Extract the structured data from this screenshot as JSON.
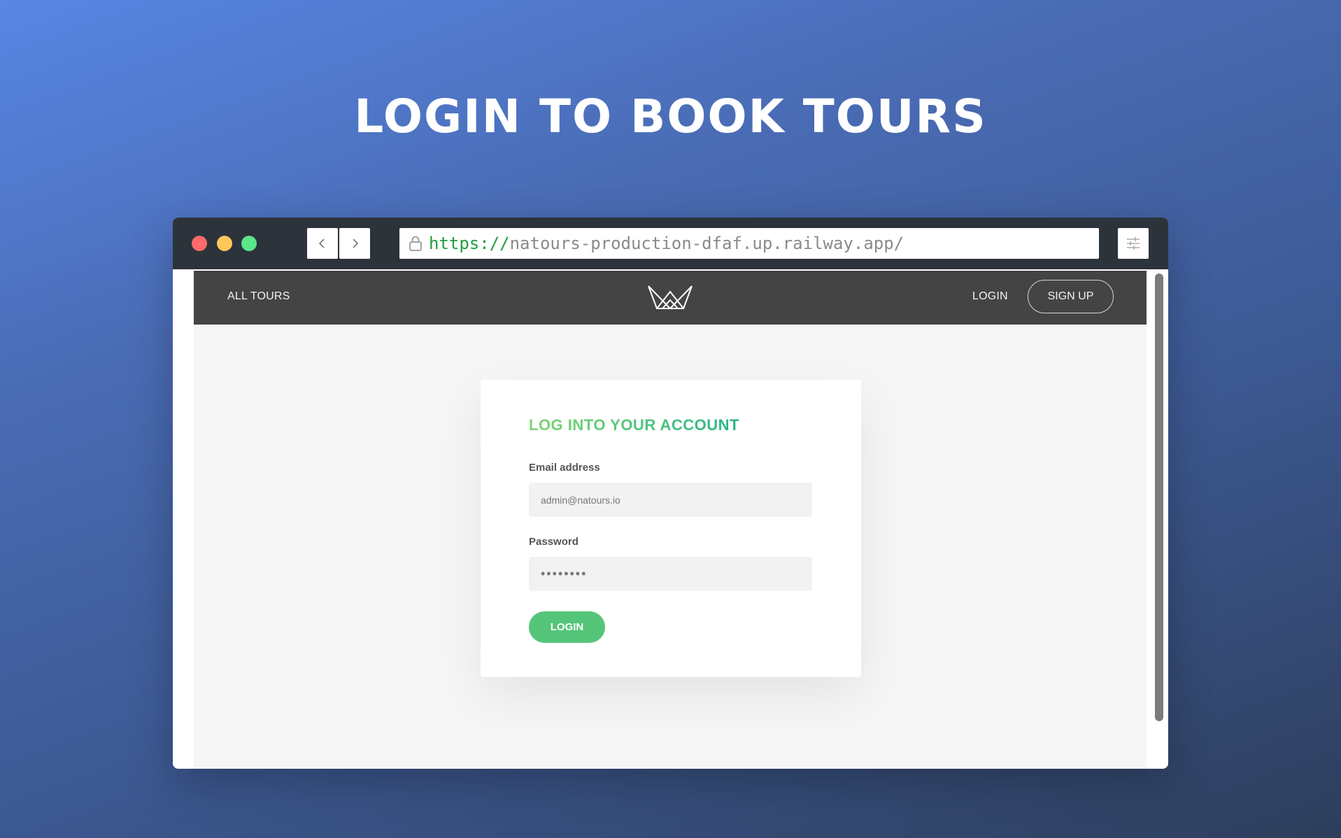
{
  "headline": "LOGIN TO BOOK TOURS",
  "browser": {
    "url_scheme": "https://",
    "url_host": "natours-production-dfaf.up.railway.app/",
    "icons": [
      "back-arrow-icon",
      "forward-arrow-icon",
      "lock-icon",
      "settings-sliders-icon"
    ],
    "traffic_lights": {
      "close": "#ff6b6b",
      "minimize": "#ffc75a",
      "maximize": "#5ce68a"
    }
  },
  "site_nav": {
    "all_tours": "ALL TOURS",
    "login": "LOGIN",
    "signup": "SIGN UP",
    "logo_icon": "natours-logo-icon"
  },
  "login_form": {
    "title": "LOG INTO YOUR ACCOUNT",
    "email_label": "Email address",
    "email_value": "admin@natours.io",
    "password_label": "Password",
    "password_value": "••••••••",
    "submit_label": "LOGIN"
  },
  "colors": {
    "accent": "#55c57a",
    "nav_bg": "#444444"
  }
}
